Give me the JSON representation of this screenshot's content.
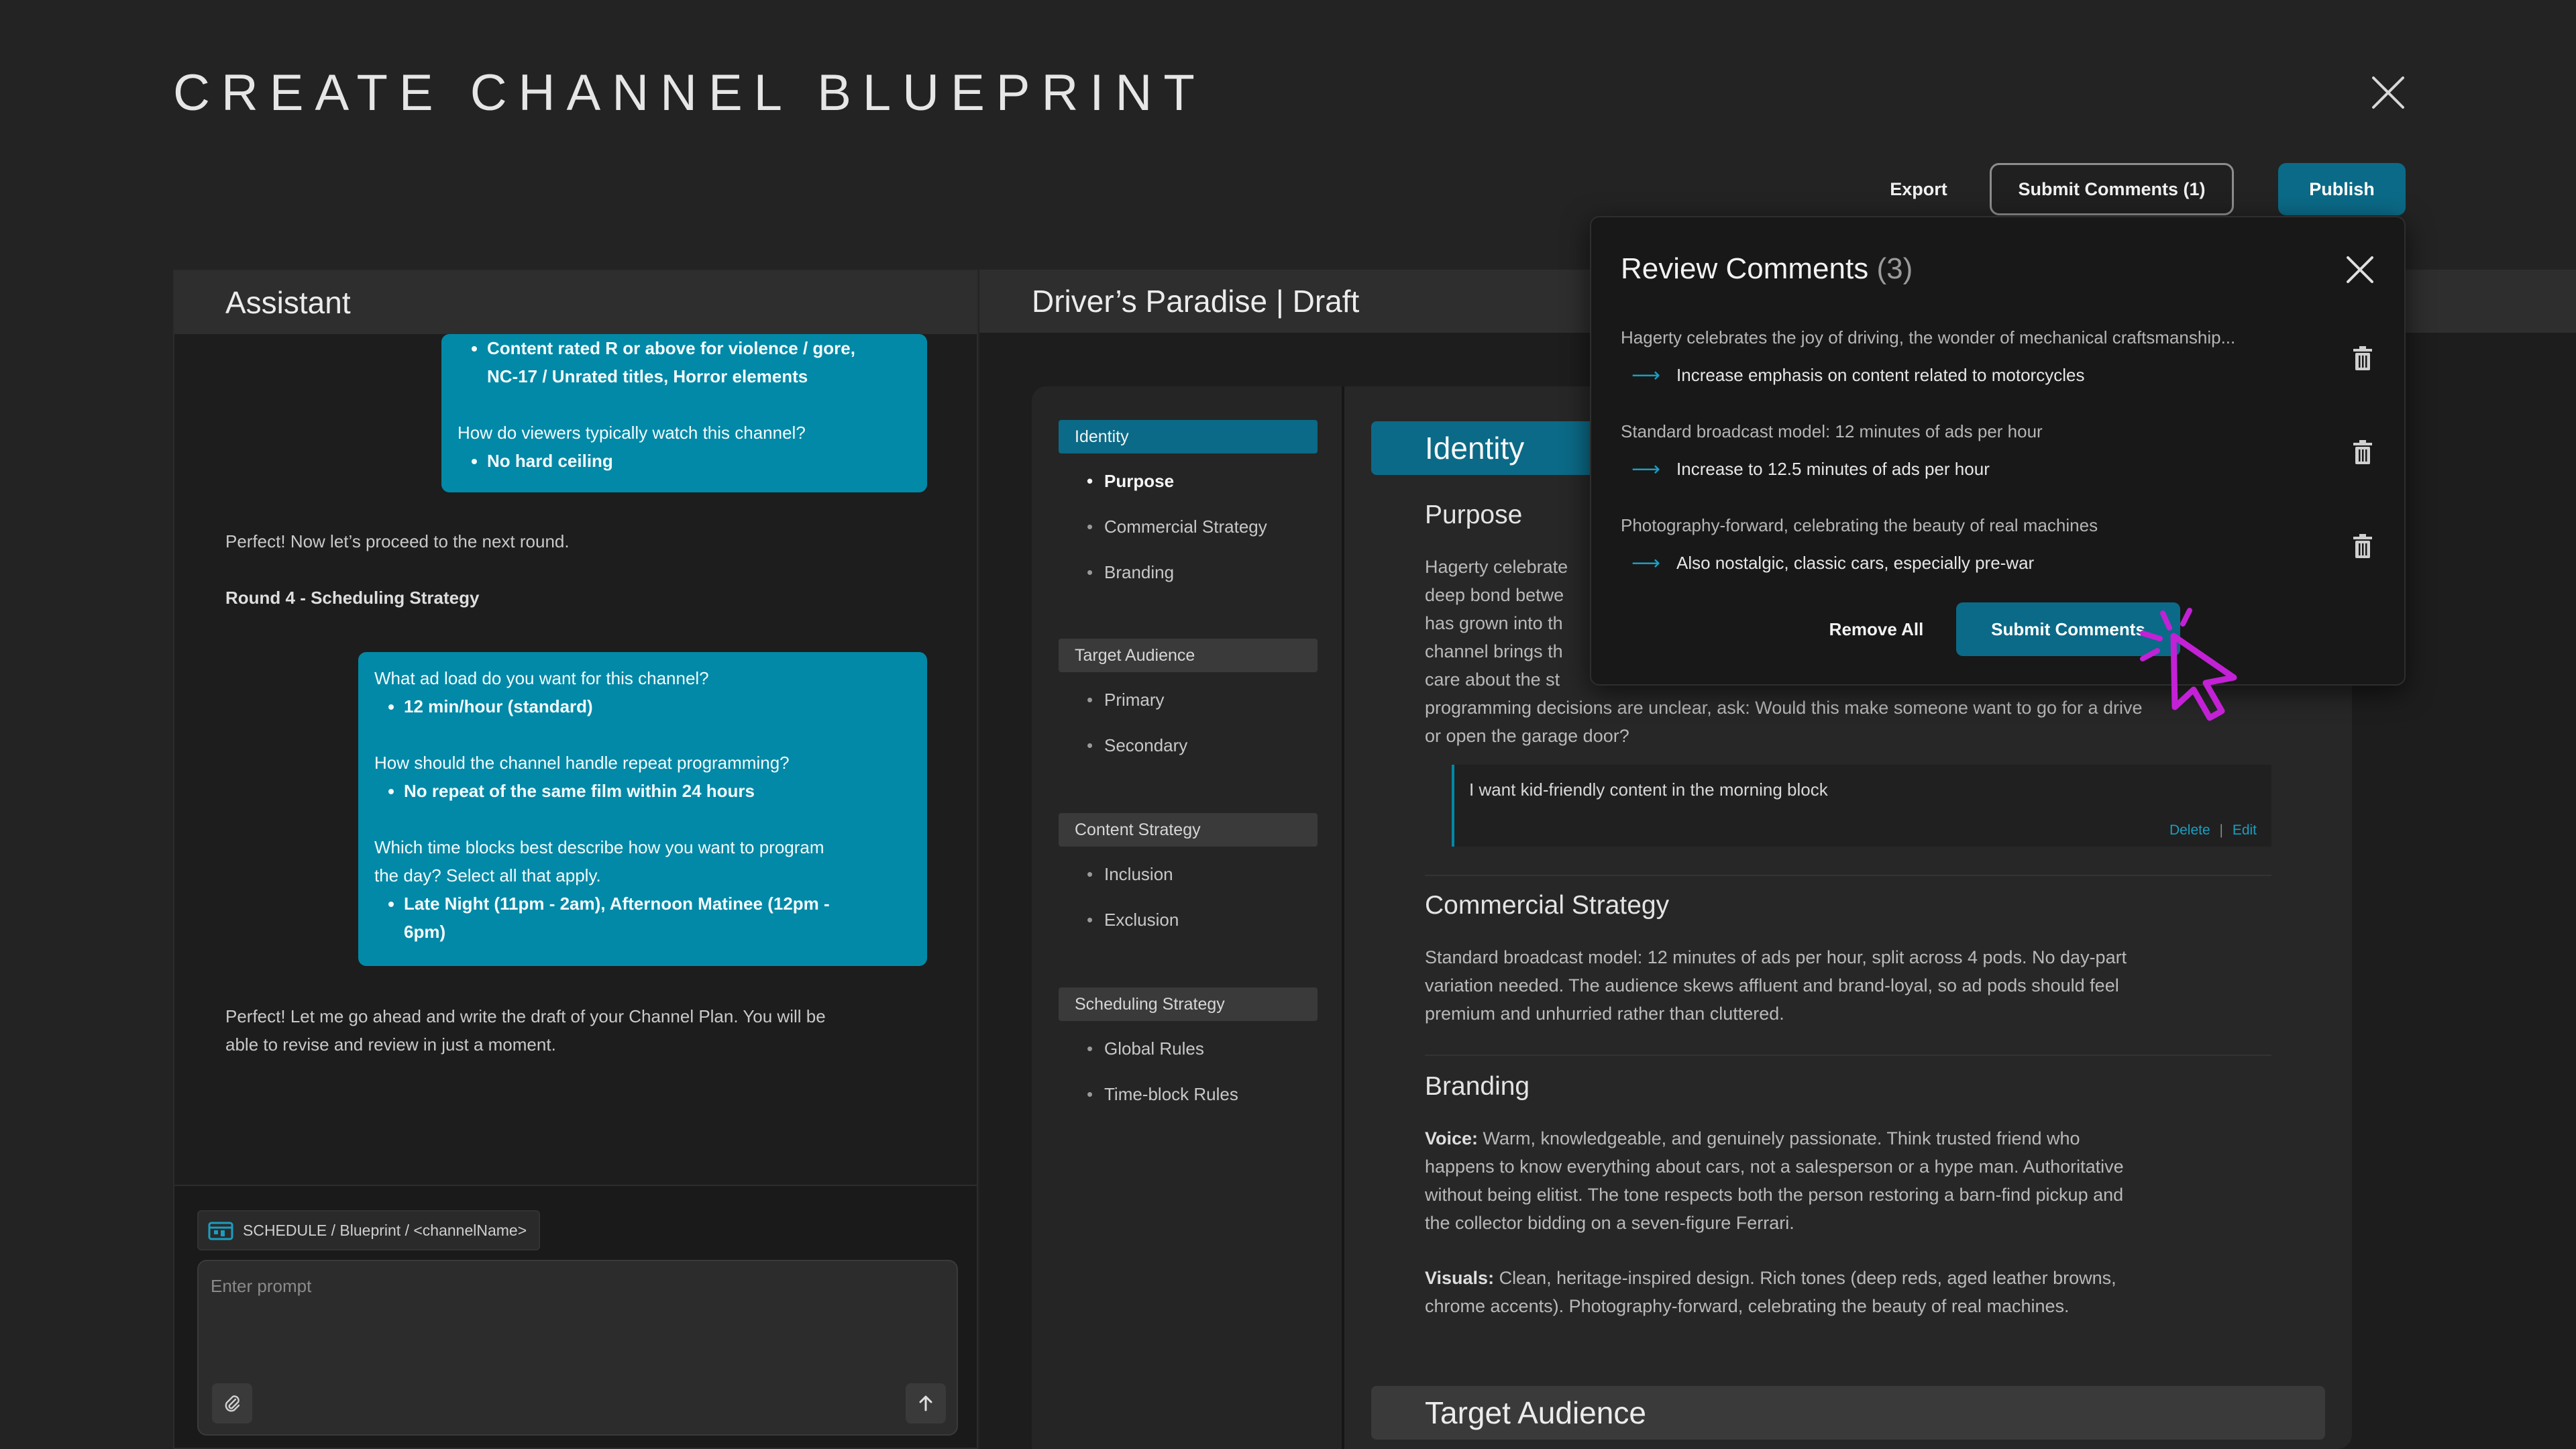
{
  "header": {
    "title": "CREATE CHANNEL BLUEPRINT",
    "export_label": "Export",
    "submit_comments_label": "Submit Comments (1)",
    "publish_label": "Publish"
  },
  "assistant": {
    "title": "Assistant",
    "bubble1": {
      "item1": "Content rated R or above for violence / gore,",
      "item1b": "NC-17 / Unrated titles, Horror elements",
      "q2": "How do viewers typically watch this channel?",
      "a2": "No hard ceiling"
    },
    "msg1": "Perfect! Now let’s proceed to the next round.",
    "round_label": "Round 4 - Scheduling Strategy",
    "bubble2": {
      "q1": "What ad load do you want for this channel?",
      "a1": "12 min/hour (standard)",
      "q2": "How should the channel handle repeat programming?",
      "a2": "No repeat of the same film within 24 hours",
      "q3a": "Which time blocks best describe how you want to program",
      "q3b": "the day? Select all that apply.",
      "a3a": "Late Night (11pm - 2am), Afternoon Matinee (12pm -",
      "a3b": "6pm)"
    },
    "msg2a": "Perfect! Let me go ahead and write the draft of your Channel Plan. You will be",
    "msg2b": "able to revise and review in just a moment.",
    "breadcrumb": "SCHEDULE / Blueprint / <channelName>",
    "prompt_placeholder": "Enter prompt"
  },
  "draft": {
    "title": "Driver’s Paradise | Draft",
    "toc": {
      "identity": "Identity",
      "identity_items": [
        "Purpose",
        "Commercial Strategy",
        "Branding"
      ],
      "target": "Target Audience",
      "target_items": [
        "Primary",
        "Secondary"
      ],
      "content": "Content Strategy",
      "content_items": [
        "Inclusion",
        "Exclusion"
      ],
      "scheduling": "Scheduling Strategy",
      "scheduling_items": [
        "Global Rules",
        "Time-block Rules"
      ]
    },
    "identity_banner": "Identity",
    "purpose_heading": "Purpose",
    "purpose_lines": [
      "Hagerty celebrate",
      "deep bond betwe",
      "has grown into th",
      "channel brings th",
      "care about the st",
      "programming decisions are unclear, ask: Would this make someone want to go for a drive",
      "or open the garage door?"
    ],
    "inline_comment": "I want kid-friendly content in the morning block",
    "comment_delete": "Delete",
    "comment_sep": "|",
    "comment_edit": "Edit",
    "commercial_heading": "Commercial Strategy",
    "commercial_lines": [
      "Standard broadcast model: 12 minutes of ads per hour, split across 4 pods. No day-part",
      "variation needed. The audience skews affluent and brand-loyal, so ad pods should feel",
      "premium and unhurried rather than cluttered."
    ],
    "branding_heading": "Branding",
    "voice_label": "Voice:",
    "voice_lines": [
      " Warm, knowledgeable, and genuinely passionate. Think trusted friend who",
      "happens to know everything about cars, not a salesperson or a hype man. Authoritative",
      "without being elitist. The tone respects both the person restoring a barn-find pickup and",
      "the collector bidding on a seven-figure Ferrari."
    ],
    "visuals_label": "Visuals:",
    "visuals_lines": [
      " Clean, heritage-inspired design. Rich tones (deep reds, aged leather browns,",
      "chrome accents). Photography-forward, celebrating the beauty of real machines."
    ],
    "target_banner": "Target Audience"
  },
  "review": {
    "title": "Review Comments",
    "count": "(3)",
    "comments": [
      {
        "original": "Hagerty celebrates the joy of driving, the wonder of mechanical craftsmanship...",
        "change": "Increase emphasis on content related to motorcycles"
      },
      {
        "original": "Standard broadcast model: 12 minutes of ads per hour",
        "change": "Increase to 12.5 minutes of ads per hour"
      },
      {
        "original": "Photography-forward, celebrating the beauty of real machines",
        "change": "Also nostalgic, classic cars, especially pre-war"
      }
    ],
    "remove_all_label": "Remove All",
    "submit_label": "Submit Comments"
  },
  "colors": {
    "accent": "#0b6a87",
    "bubble": "#0289a7",
    "cursor": "#c321d6"
  }
}
